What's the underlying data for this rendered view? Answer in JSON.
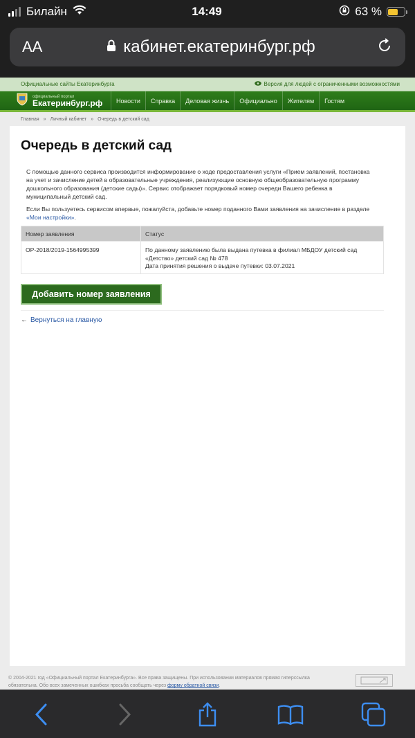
{
  "status_bar": {
    "carrier": "Билайн",
    "time": "14:49",
    "battery_percent": "63 %",
    "battery_level": 0.63,
    "icons": [
      "signal-icon",
      "wifi-icon",
      "rotation-lock-icon",
      "battery-icon"
    ]
  },
  "browser": {
    "text_size_label": "AA",
    "url": "кабинет.екатеринбург.рф",
    "icons": [
      "lock-icon",
      "reload-icon",
      "back-icon",
      "forward-icon",
      "share-icon",
      "bookmarks-icon",
      "tabs-icon"
    ]
  },
  "site": {
    "top_link": "Официальные сайты Екатеринбурга",
    "vision_link": "Версия для людей с ограниченными возможностями",
    "logo_small": "официальный портал",
    "logo_big": "Екатеринбург.рф",
    "menu": [
      "Новости",
      "Справка",
      "Деловая жизнь",
      "Официально",
      "Жителям",
      "Гостям"
    ]
  },
  "breadcrumbs": [
    "Главная",
    "»",
    "Личный кабинет",
    "»",
    "Очередь в детский сад"
  ],
  "page": {
    "title": "Очередь в детский сад",
    "intro": "С помощью данного сервиса производится информирование о ходе предоставления услуги «Прием заявлений, постановка на учет и зачисление детей в образовательные учреждения, реализующие основную общеобразовательную программу дошкольного образования (детские сады)». Сервис отображает порядковый номер очереди Вашего ребенка в муниципальный детский сад.",
    "hint_prefix": "Если Вы пользуетесь сервисом впервые, пожалуйста, добавьте номер поданного Вами заявления на зачисление в разделе ",
    "hint_link": "«Мои настройки»",
    "hint_suffix": ".",
    "table": {
      "headers": [
        "Номер заявления",
        "Статус"
      ],
      "rows": [
        {
          "number": "OP-2018/2019-1564995399",
          "status_line1": "По данному заявлению была выдана путевка в филиал МБДОУ детский сад «Детство» детский сад № 478",
          "status_line2": "Дата принятия решения о выдаче путевки: 03.07.2021"
        }
      ]
    },
    "add_button": "Добавить номер заявления",
    "back_arrow": "←",
    "back_link": "Вернуться на главную"
  },
  "footer": {
    "copyright": "© 2004-2021 год «Официальный портал Екатеринбурга». Все права защищены. При использовании материалов прямая гиперссылка обязательна. Обо всех замеченных ошибках просьба сообщать через ",
    "feedback_link": "форму обратной связи",
    "period": "."
  },
  "colors": {
    "brand_green": "#2c6a1e",
    "link_blue": "#2b5aa5",
    "ios_blue": "#3d8ef2"
  }
}
